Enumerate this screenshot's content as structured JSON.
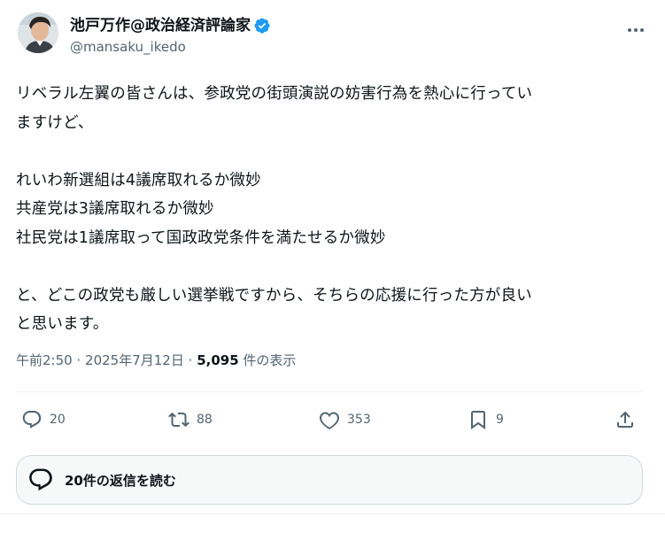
{
  "author": {
    "display_name": "池戸万作@政治経済評論家",
    "handle": "@mansaku_ikedo"
  },
  "tweet": {
    "text": "リベラル左翼の皆さんは、参政党の街頭演説の妨害行為を熱心に行ってい\nますけど、\n\nれいわ新選組は4議席取れるか微妙\n共産党は3議席取れるか微妙\n社民党は1議席取って国政政党条件を満たせるか微妙\n\nと、どこの政党も厳しい選挙戦ですから、そちらの応援に行った方が良い\nと思います。",
    "time": "午前2:50",
    "separator": "·",
    "date": "2025年7月12日",
    "views_count": "5,095",
    "views_label": "件の表示"
  },
  "actions": {
    "replies": "20",
    "retweets": "88",
    "likes": "353",
    "bookmarks": "9"
  },
  "replies_bar": {
    "label": "20件の返信を読む"
  },
  "colors": {
    "text": "#0f1419",
    "secondary": "#536471",
    "verified": "#1d9bf0",
    "border": "#cfd9de"
  },
  "icons": [
    "verified-icon",
    "more-icon",
    "reply-icon",
    "retweet-icon",
    "like-icon",
    "bookmark-icon",
    "share-icon",
    "replies-bubble-icon"
  ]
}
